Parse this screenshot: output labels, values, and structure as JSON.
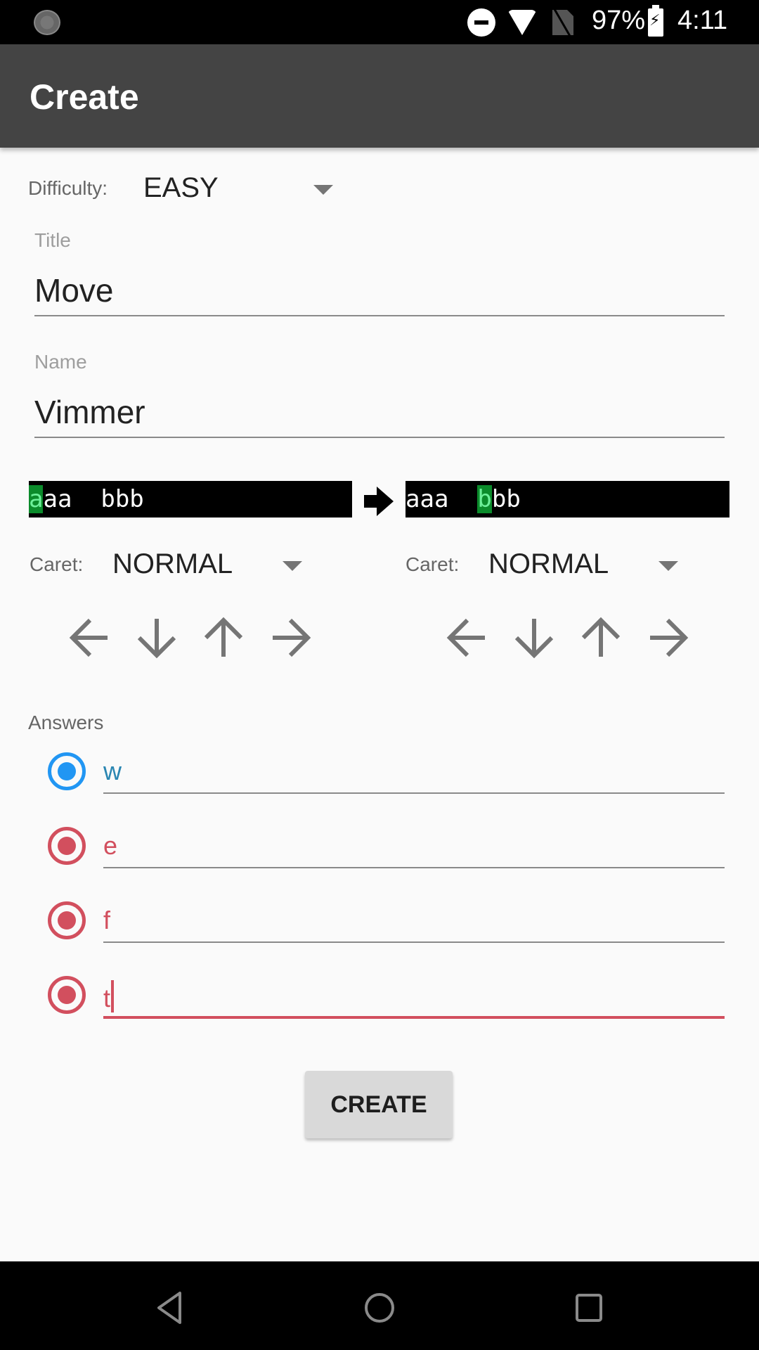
{
  "status_bar": {
    "battery_percent": "97%",
    "time": "4:11",
    "icons": [
      "sync-icon",
      "do-not-disturb-icon",
      "wifi-icon",
      "no-sim-icon",
      "battery-charging-icon"
    ]
  },
  "app_bar": {
    "title": "Create"
  },
  "difficulty": {
    "label": "Difficulty:",
    "value": "EASY"
  },
  "title_field": {
    "label": "Title",
    "value": "Move"
  },
  "name_field": {
    "label": "Name",
    "value": "Vimmer"
  },
  "before": {
    "cursor_char": "a",
    "text_before_cursor": "",
    "text_after_cursor": "aa  bbb",
    "caret_label": "Caret:",
    "caret_value": "NORMAL",
    "arrows": [
      "left",
      "down",
      "up",
      "right"
    ]
  },
  "after": {
    "cursor_char": "b",
    "text_before_cursor": "aaa  ",
    "text_after_cursor": "bb",
    "caret_label": "Caret:",
    "caret_value": "NORMAL",
    "arrows": [
      "left",
      "down",
      "up",
      "right"
    ]
  },
  "answers": {
    "label": "Answers",
    "items": [
      {
        "value": "w",
        "state": "correct",
        "color": "#2196f3"
      },
      {
        "value": "e",
        "state": "wrong",
        "color": "#d24f5e"
      },
      {
        "value": "f",
        "state": "wrong",
        "color": "#d24f5e"
      },
      {
        "value": "t",
        "state": "wrong",
        "color": "#d24f5e",
        "focused": true
      }
    ]
  },
  "create_button": {
    "label": "CREATE"
  },
  "colors": {
    "app_bar": "#444444",
    "cursor_green": "#0b8b2b",
    "correct_blue": "#2196f3",
    "wrong_red": "#d24f5e"
  }
}
